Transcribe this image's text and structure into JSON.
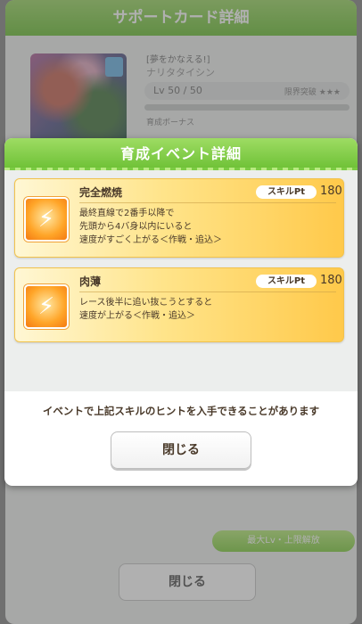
{
  "background": {
    "title": "サポートカード詳細",
    "card_name": "[夢をかなえる!]",
    "card_sub": "ナリタタイシン",
    "level": "Lv 50 / 50",
    "level_right": "限界突破 ★★★",
    "bonus_label": "育成ボーナス",
    "green_button": "最大Lv・上限解放",
    "close_label": "閉じる"
  },
  "modal": {
    "title": "育成イベント詳細",
    "pt_label": "スキルPt",
    "skills": [
      {
        "name": "完全燃焼",
        "pt": "180",
        "icon": "speed-skill-icon",
        "description": "最終直線で2番手以降で\n先頭から4バ身以内にいると\n速度がすごく上がる＜作戦・追込＞"
      },
      {
        "name": "肉薄",
        "pt": "180",
        "icon": "speed-skill-icon",
        "description": "レース後半に追い抜こうとすると\n速度が上がる＜作戦・追込＞"
      }
    ],
    "notice": "イベントで上記スキルのヒントを入手できることがあります",
    "close_label": "閉じる"
  },
  "colors": {
    "header_green": "#72c23e",
    "card_orange": "#ffc94a",
    "text_brown": "#4a3a2a"
  }
}
